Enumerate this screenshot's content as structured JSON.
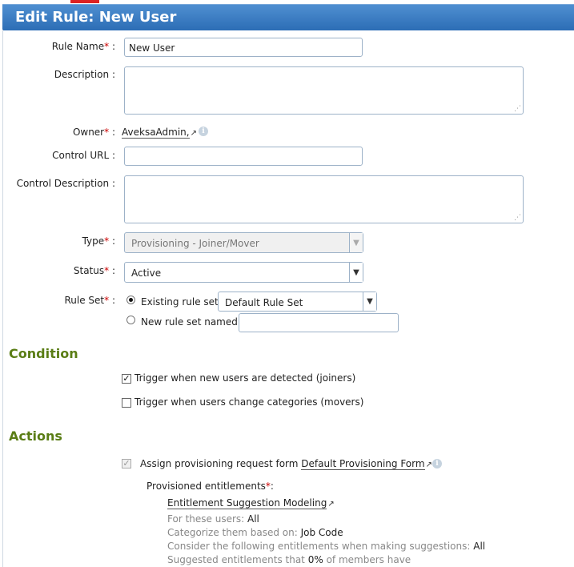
{
  "page": {
    "title": "Edit Rule: New User"
  },
  "form": {
    "rule_name": {
      "label": "Rule Name",
      "value": "New User"
    },
    "description": {
      "label": "Description",
      "value": ""
    },
    "owner": {
      "label": "Owner",
      "value": "AveksaAdmin,"
    },
    "control_url": {
      "label": "Control URL",
      "value": ""
    },
    "control_description": {
      "label": "Control Description",
      "value": ""
    },
    "type": {
      "label": "Type",
      "value": "Provisioning - Joiner/Mover"
    },
    "status": {
      "label": "Status",
      "value": "Active"
    },
    "rule_set": {
      "label": "Rule Set",
      "existing_label": "Existing rule set",
      "existing_value": "Default Rule Set",
      "new_label": "New rule set named",
      "new_value": ""
    },
    "colon": ":",
    "required_mark": "*"
  },
  "condition": {
    "heading": "Condition",
    "joiners": {
      "label": "Trigger when new users are detected (joiners)",
      "checked": true
    },
    "movers": {
      "label": "Trigger when users change categories (movers)",
      "checked": false
    }
  },
  "actions": {
    "heading": "Actions",
    "assign_label": "Assign provisioning request form",
    "form_link": "Default Provisioning Form",
    "provisioned_label": "Provisioned entitlements",
    "suggestion_link": "Entitlement Suggestion Modeling",
    "details": [
      {
        "label": "For these users:",
        "value": "All"
      },
      {
        "label": "Categorize them based on:",
        "value": "Job Code"
      },
      {
        "label": "Consider the following entitlements when making suggestions:",
        "value": "All"
      },
      {
        "label": "Suggested entitlements that",
        "value": "0%",
        "suffix": "of members have"
      }
    ]
  },
  "colors": {
    "title_bar": "#2c6db5",
    "section_heading": "#5a7d15",
    "required": "#cc0000"
  }
}
